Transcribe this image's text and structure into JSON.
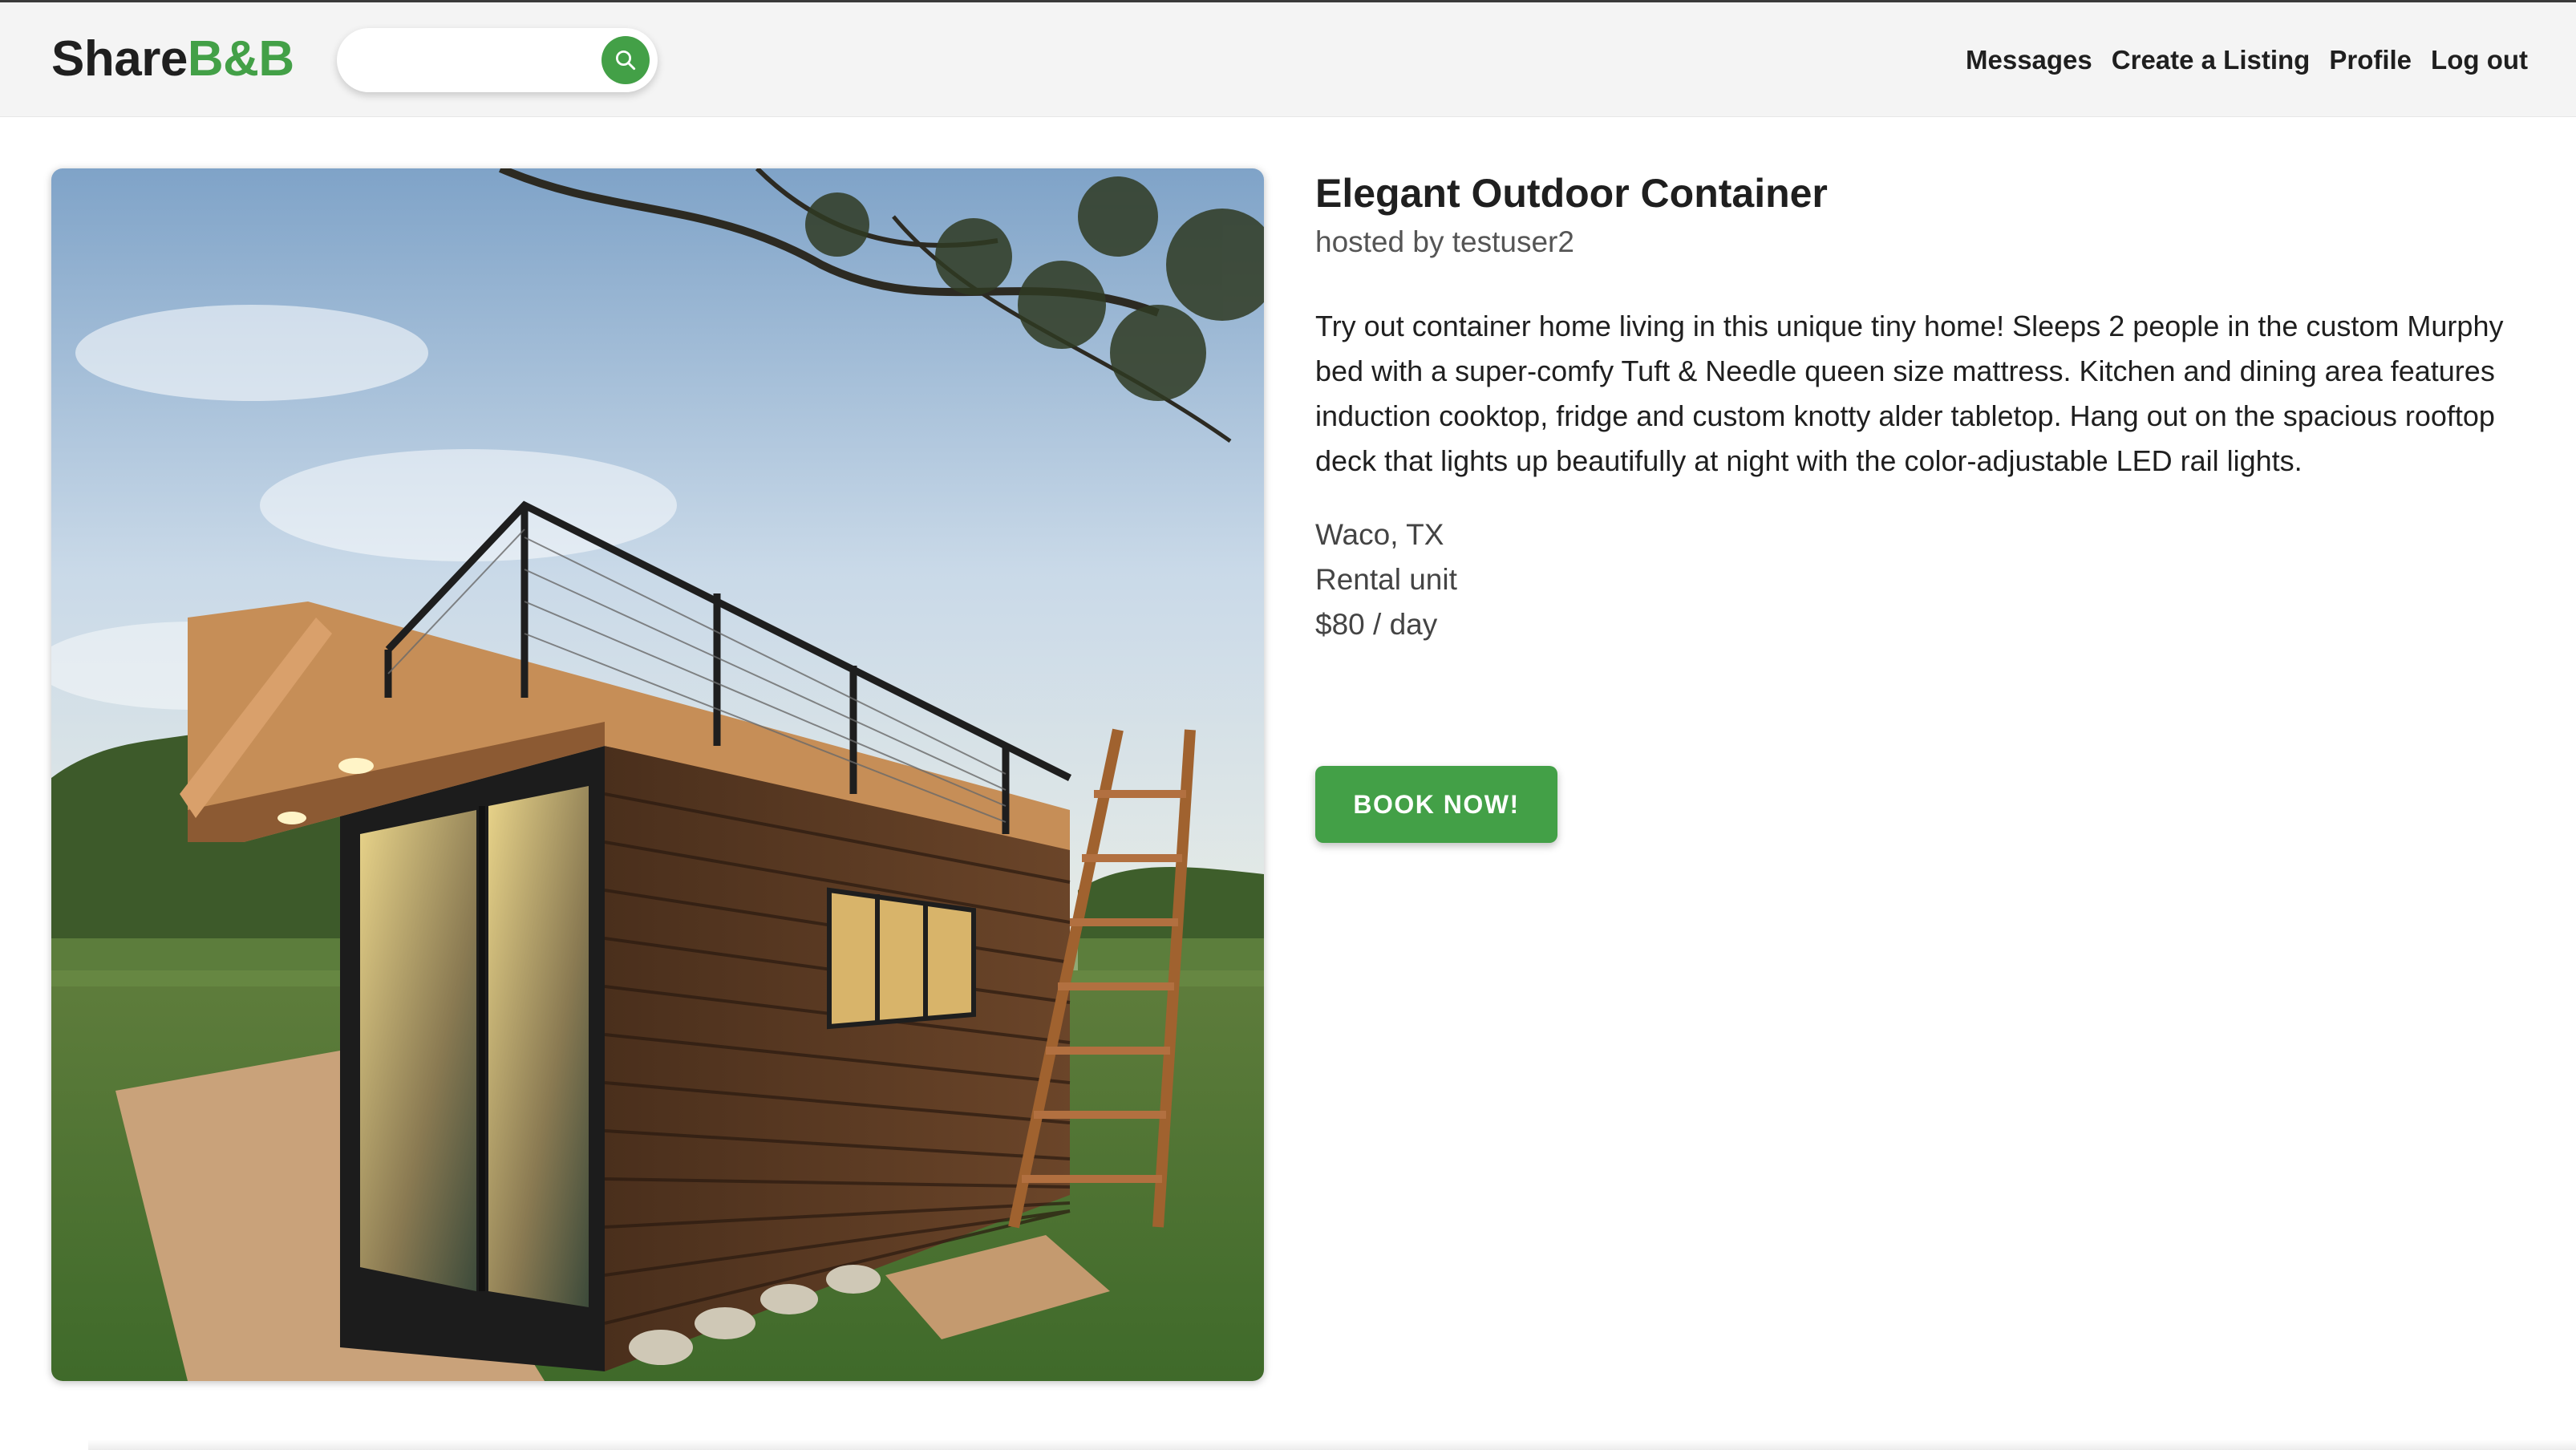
{
  "brand": {
    "part1": "Share",
    "part2": "B&B"
  },
  "search": {
    "placeholder": "",
    "value": ""
  },
  "nav": {
    "messages": "Messages",
    "create_listing": "Create a Listing",
    "profile": "Profile",
    "logout": "Log out"
  },
  "listing": {
    "title": "Elegant Outdoor Container",
    "host": "hosted by testuser2",
    "description": "Try out container home living in this unique tiny home! Sleeps 2 people in the custom Murphy bed with a super-comfy Tuft & Needle queen size mattress. Kitchen and dining area features induction cooktop, fridge and custom knotty alder tabletop. Hang out on the spacious rooftop deck that lights up beautifully at night with the color-adjustable LED rail lights.",
    "location": "Waco, TX",
    "type": "Rental unit",
    "price": "$80 / day",
    "book_label": "BOOK NOW!"
  },
  "colors": {
    "accent": "#43a047",
    "navbar_bg": "#f4f4f4",
    "text": "#1f1f1f"
  },
  "icons": {
    "search_button": "search-icon"
  }
}
